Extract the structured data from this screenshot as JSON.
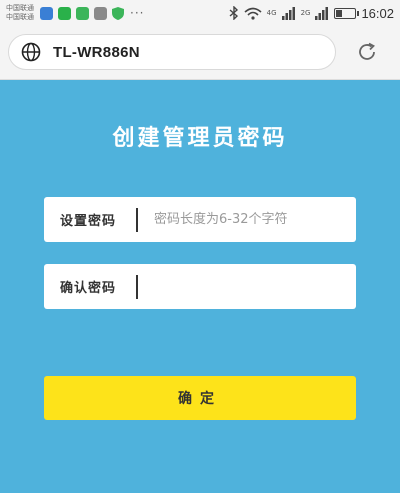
{
  "status_bar": {
    "carrier_line1": "中国联通",
    "carrier_line2": "中国联通",
    "more": "···",
    "net1": "4G",
    "net2": "2G",
    "battery_level": 0.3,
    "time": "16:02"
  },
  "browser": {
    "url": "TL-WR886N",
    "globe_icon": "globe-icon",
    "reload_icon": "reload-icon"
  },
  "page": {
    "title": "创建管理员密码",
    "set_password": {
      "label": "设置密码",
      "placeholder": "密码长度为6-32个字符",
      "value": ""
    },
    "confirm_password": {
      "label": "确认密码",
      "placeholder": "",
      "value": ""
    },
    "confirm_button": "确定"
  },
  "colors": {
    "background": "#4fb2dc",
    "button": "#fde31a"
  }
}
